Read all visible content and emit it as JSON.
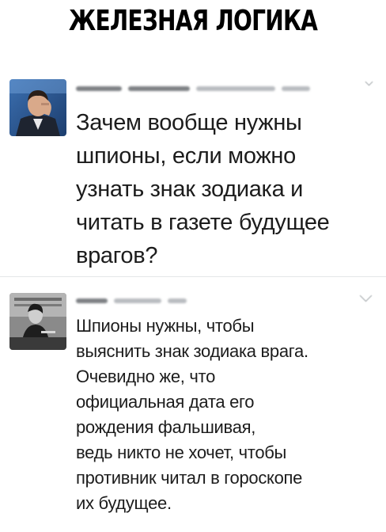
{
  "headline": "ЖЕЛЕЗНАЯ ЛОГИКА",
  "tweets": [
    {
      "text": "Зачем вообще нужны\nшпионы, если можно\nузнать знак зодиака и\nчитать в газете будущее\nврагов?"
    },
    {
      "text": "Шпионы нужны, чтобы\nвыяснить знак зодиака врага.\nОчевидно же, что\nофициальная дата его\nрождения фальшивая,\nведь никто не хочет, чтобы\nпротивник читал в гороскопе\nих будущее."
    }
  ],
  "icons": {
    "menu": "chevron-down-icon"
  },
  "colors": {
    "text": "#1c1c1c",
    "divider": "#e4e6e8",
    "muted": "#a0a4a8"
  }
}
